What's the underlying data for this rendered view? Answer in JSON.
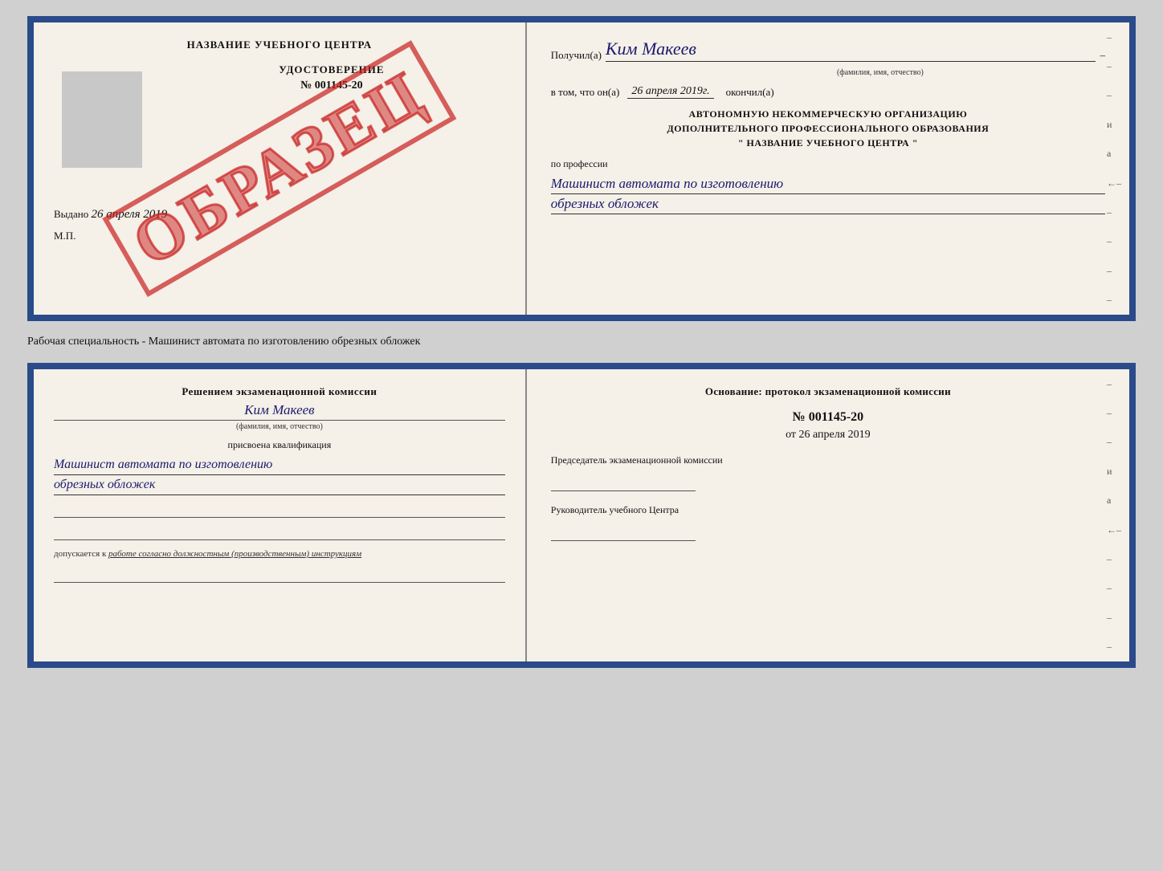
{
  "top_doc": {
    "left": {
      "training_center": "НАЗВАНИЕ УЧЕБНОГО ЦЕНТРА",
      "watermark": "ОБРАЗЕЦ",
      "udostoverenie": "УДОСТОВЕРЕНИЕ",
      "number": "№ 001145-20",
      "vydano_label": "Выдано",
      "vydano_date": "26 апреля 2019",
      "mp": "М.П."
    },
    "right": {
      "poluchil_label": "Получил(а)",
      "recipient_name": "Ким Макеев",
      "fio_subtext": "(фамилия, имя, отчество)",
      "v_tom_chto": "в том, что он(а)",
      "date_value": "26 апреля 2019г.",
      "okonchil": "окончил(а)",
      "org_line1": "АВТОНОМНУЮ НЕКОММЕРЧЕСКУЮ ОРГАНИЗАЦИЮ",
      "org_line2": "ДОПОЛНИТЕЛЬНОГО ПРОФЕССИОНАЛЬНОГО ОБРАЗОВАНИЯ",
      "org_line3": "\"  НАЗВАНИЕ УЧЕБНОГО ЦЕНТРА  \"",
      "po_professii": "по профессии",
      "profession_line1": "Машинист автомата по изготовлению",
      "profession_line2": "обрезных обложек",
      "dashes": [
        "-",
        "-",
        "-",
        "и",
        "а",
        "←",
        "-",
        "-",
        "-",
        "-"
      ]
    }
  },
  "specialty_row": {
    "text": "Рабочая специальность - Машинист автомата по изготовлению обрезных обложек"
  },
  "bottom_doc": {
    "left": {
      "resheniem_label": "Решением экзаменационной комиссии",
      "person_name": "Ким Макеев",
      "fio_subtext": "(фамилия, имя, отчество)",
      "prisvoena": "присвоена квалификация",
      "qualification_line1": "Машинист автомата по изготовлению",
      "qualification_line2": "обрезных обложек",
      "dopuskaetsya_label": "допускается к",
      "dopuskaetsya_value": "работе согласно должностным (производственным) инструкциям"
    },
    "right": {
      "osnovanie_label": "Основание: протокол экзаменационной комиссии",
      "number": "№ 001145-20",
      "ot_label": "от",
      "ot_date": "26 апреля 2019",
      "predsedatel_label": "Председатель экзаменационной комиссии",
      "rukovoditel_label": "Руководитель учебного Центра",
      "dashes": [
        "-",
        "-",
        "-",
        "и",
        "а",
        "←",
        "-",
        "-",
        "-",
        "-"
      ]
    }
  }
}
